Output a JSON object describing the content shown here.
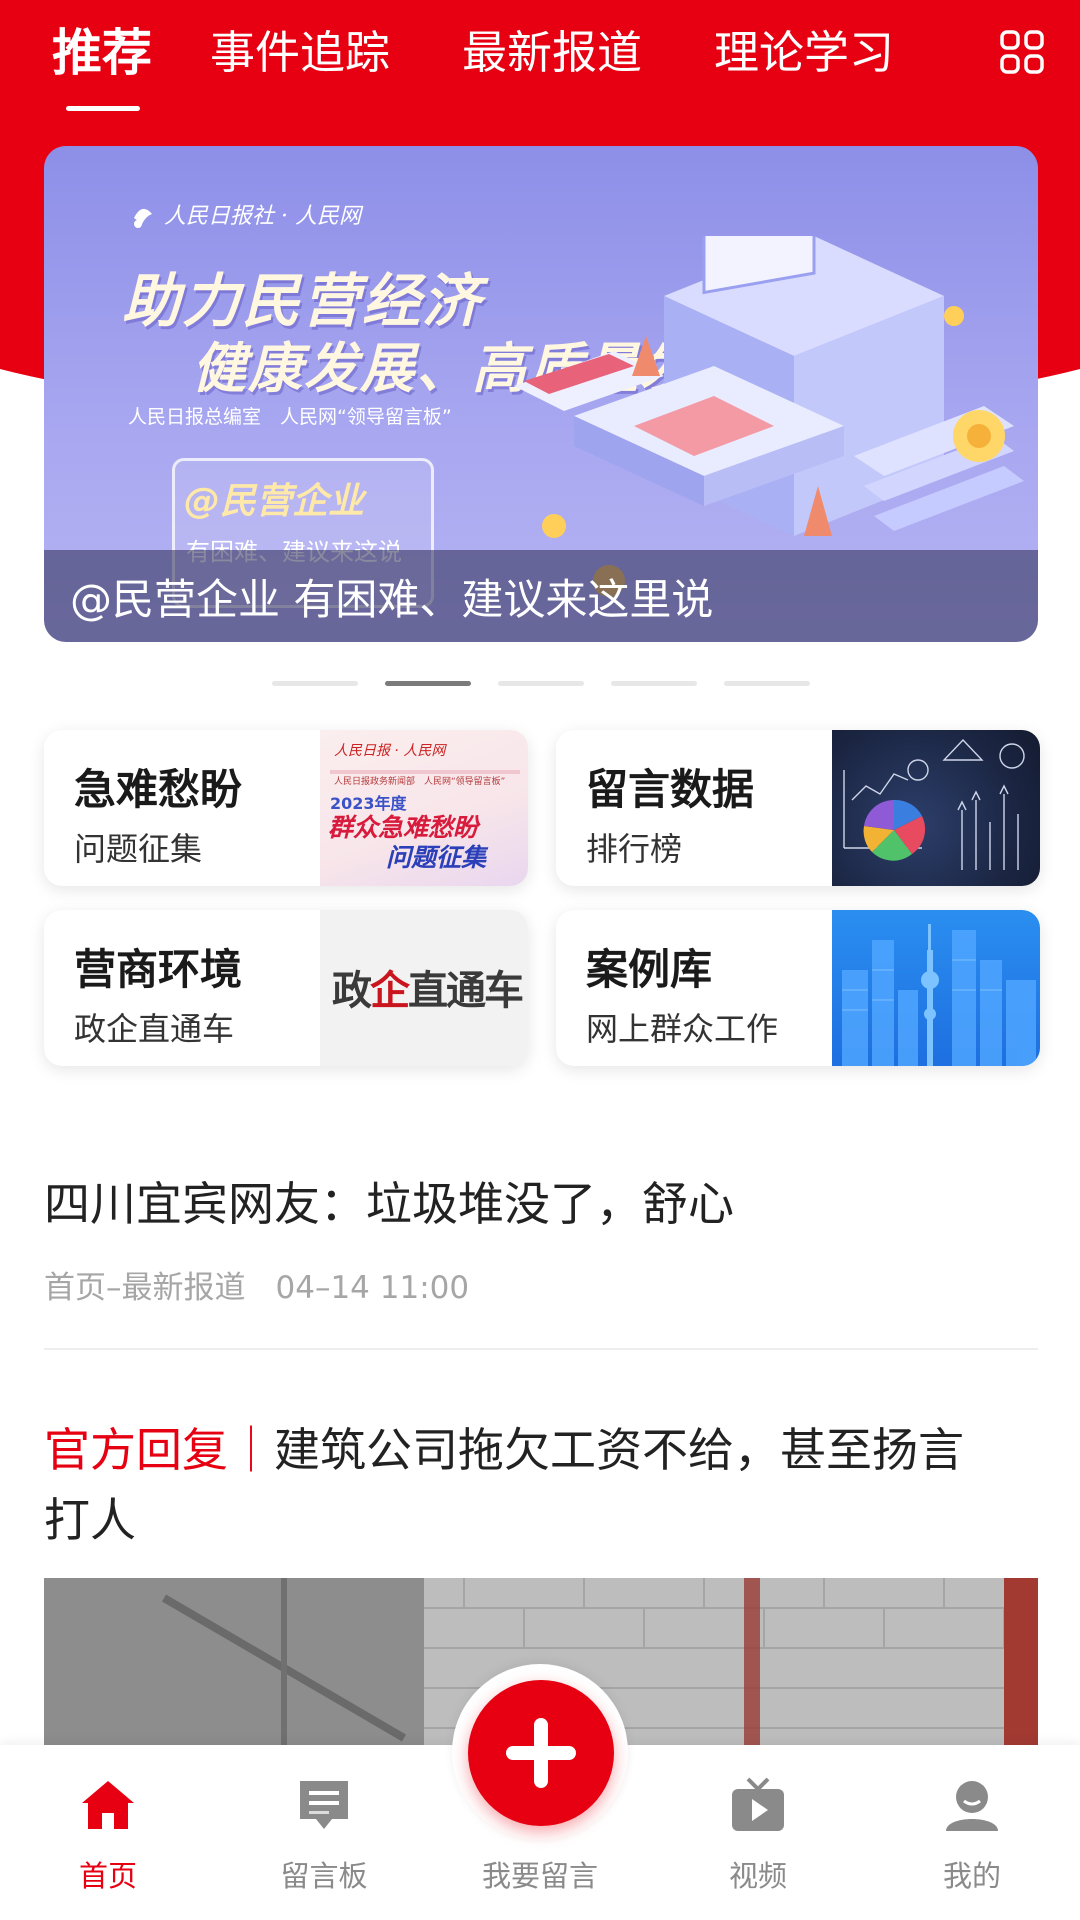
{
  "tabs": [
    {
      "label": "推荐"
    },
    {
      "label": "事件追踪"
    },
    {
      "label": "最新报道"
    },
    {
      "label": "理论学习"
    }
  ],
  "banner": {
    "logo_text": "人民日报社 · 人民网",
    "title_line1": "助力民营经济",
    "title_line2": "健康发展、高质量发展",
    "subtitle": "人民日报总编室　人民网“领导留言板”",
    "card_tag": "@民营企业",
    "card_line": "有困难、建议来这说",
    "caption": "@民营企业 有困难、建议来这里说",
    "active_slide": 2,
    "slide_count": 5
  },
  "feature_cards": [
    {
      "title": "急难愁盼",
      "subtitle": "问题征集",
      "thumb": {
        "logo": "人民日报 · 人民网",
        "line1": "人民日报政务新闻部　人民网“领导留言板”",
        "line2": "2023年度",
        "line3": "群众急难愁盼",
        "line4": "问题征集"
      }
    },
    {
      "title": "留言数据",
      "subtitle": "排行榜"
    },
    {
      "title": "营商环境",
      "subtitle": "政企直通车",
      "thumb": {
        "text_a": "政",
        "text_b": "企",
        "text_c": "直通车"
      }
    },
    {
      "title": "案例库",
      "subtitle": "网上群众工作"
    }
  ],
  "articles": [
    {
      "title": "四川宜宾网友：垃圾堆没了，舒心",
      "meta_channel": "首页–最新报道",
      "meta_time": "04–14 11:00"
    },
    {
      "tag": "官方回复｜",
      "title_line1": "建筑公司拖欠工资不给，甚至扬言",
      "title_line2": "打人"
    }
  ],
  "bottom_nav": [
    {
      "label": "首页",
      "icon": "home-icon",
      "active": true
    },
    {
      "label": "留言板",
      "icon": "message-board-icon",
      "active": false
    },
    {
      "label": "我要留言",
      "icon": "plus-icon",
      "active": false
    },
    {
      "label": "视频",
      "icon": "video-icon",
      "active": false
    },
    {
      "label": "我的",
      "icon": "user-icon",
      "active": false
    }
  ],
  "colors": {
    "brand_red": "#e60012",
    "nav_inactive": "#8a8a8a",
    "meta_gray": "#a6a6a6"
  }
}
